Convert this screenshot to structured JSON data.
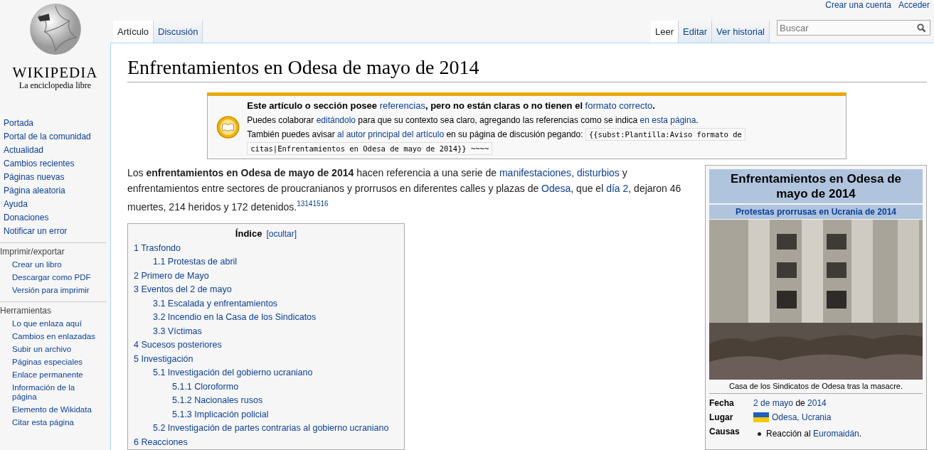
{
  "personal_links": [
    "Crear una cuenta",
    "Acceder"
  ],
  "logo": {
    "wordmark": "WIKIPEDIA",
    "tagline": "La enciclopedia libre"
  },
  "sidebar": {
    "navigation": [
      "Portada",
      "Portal de la comunidad",
      "Actualidad",
      "Cambios recientes",
      "Páginas nuevas",
      "Página aleatoria",
      "Ayuda",
      "Donaciones",
      "Notificar un error"
    ],
    "sections": [
      {
        "heading": "Imprimir/exportar",
        "items": [
          "Crear un libro",
          "Descargar como PDF",
          "Versión para imprimir"
        ]
      },
      {
        "heading": "Herramientas",
        "items": [
          "Lo que enlaza aquí",
          "Cambios en enlazadas",
          "Subir un archivo",
          "Páginas especiales",
          "Enlace permanente",
          "Información de la página",
          "Elemento de Wikidata",
          "Citar esta página"
        ]
      }
    ]
  },
  "left_tabs": [
    {
      "label": "Artículo",
      "selected": true
    },
    {
      "label": "Discusión",
      "selected": false
    }
  ],
  "right_tabs": [
    {
      "label": "Leer",
      "selected": true
    },
    {
      "label": "Editar",
      "selected": false
    },
    {
      "label": "Ver historial",
      "selected": false
    }
  ],
  "search": {
    "placeholder": "Buscar"
  },
  "title": "Enfrentamientos en Odesa de mayo de 2014",
  "notice": {
    "lines": [
      [
        {
          "kind": "bold",
          "text": "Este artículo o sección posee "
        },
        {
          "kind": "link",
          "text": "referencias"
        },
        {
          "kind": "bold",
          "text": ", pero no están claras o no tienen el "
        },
        {
          "kind": "link",
          "text": "formato correcto"
        },
        {
          "kind": "bold",
          "text": "."
        }
      ],
      [
        {
          "kind": "plain",
          "text": "Puedes colaborar "
        },
        {
          "kind": "link",
          "text": "editándolo"
        },
        {
          "kind": "plain",
          "text": " para que su contexto sea claro, agregando las referencias como se indica "
        },
        {
          "kind": "link",
          "text": "en esta página"
        },
        {
          "kind": "plain",
          "text": "."
        }
      ],
      [
        {
          "kind": "plain",
          "text": "También puedes avisar "
        },
        {
          "kind": "link",
          "text": "al autor principal del artículo"
        },
        {
          "kind": "plain",
          "text": " en su página de discusión pegando: "
        },
        {
          "kind": "code",
          "text": "{{subst:Plantilla:Aviso formato de"
        },
        {
          "kind": "code",
          "text": "citas|Enfrentamientos en Odesa de mayo de 2014}} ~~~~"
        }
      ]
    ]
  },
  "intro": [
    {
      "kind": "plain",
      "text": "Los "
    },
    {
      "kind": "bold",
      "text": "enfrentamientos en Odesa de mayo de 2014"
    },
    {
      "kind": "plain",
      "text": " hacen referencia a una serie de "
    },
    {
      "kind": "link",
      "text": "manifestaciones"
    },
    {
      "kind": "plain",
      "text": ", "
    },
    {
      "kind": "link",
      "text": "disturbios"
    },
    {
      "kind": "plain",
      "text": " y enfrentamientos entre sectores de proucranianos y prorrusos en diferentes calles y plazas de "
    },
    {
      "kind": "link",
      "text": "Odesa"
    },
    {
      "kind": "plain",
      "text": ", que el "
    },
    {
      "kind": "link",
      "text": "día 2"
    },
    {
      "kind": "plain",
      "text": ", dejaron 46 muertes, 214 heridos y 172 detenidos."
    },
    {
      "kind": "ref",
      "text": "13"
    },
    {
      "kind": "ref",
      "text": "14"
    },
    {
      "kind": "ref",
      "text": "15"
    },
    {
      "kind": "ref",
      "text": "16"
    }
  ],
  "toc": {
    "title": "Índice",
    "toggle": "[ocultar]",
    "entries": [
      {
        "label": "1 Trasfondo",
        "children": [
          {
            "label": "1.1 Protestas de abril"
          }
        ]
      },
      {
        "label": "2 Primero de Mayo"
      },
      {
        "label": "3 Eventos del 2 de mayo",
        "children": [
          {
            "label": "3.1 Escalada y enfrentamientos"
          },
          {
            "label": "3.2 Incendio en la Casa de los Sindicatos"
          },
          {
            "label": "3.3 Víctimas"
          }
        ]
      },
      {
        "label": "4 Sucesos posteriores"
      },
      {
        "label": "5 Investigación",
        "children": [
          {
            "label": "5.1 Investigación del gobierno ucraniano",
            "children": [
              {
                "label": "5.1.1 Cloroformo"
              },
              {
                "label": "5.1.2 Nacionales rusos"
              },
              {
                "label": "5.1.3 Implicación policial"
              }
            ]
          },
          {
            "label": "5.2 Investigación de partes contrarias al gobierno ucraniano"
          }
        ]
      },
      {
        "label": "6 Reacciones"
      }
    ]
  },
  "infobox": {
    "title": "Enfrentamientos en Odesa de mayo de 2014",
    "subtitle": "Protestas prorrusas en Ucrania de 2014",
    "caption": "Casa de los Sindicatos de Odesa tras la masacre.",
    "rows": [
      {
        "label": "Fecha",
        "value": [
          {
            "kind": "link",
            "text": "2 de mayo"
          },
          {
            "kind": "plain",
            "text": " de "
          },
          {
            "kind": "link",
            "text": "2014"
          }
        ]
      },
      {
        "label": "Lugar",
        "flag": true,
        "value": [
          {
            "kind": "link",
            "text": "Odesa, Ucrania"
          }
        ]
      },
      {
        "label": "Causas",
        "bullets": [
          [
            {
              "kind": "plain",
              "text": "Reacción al "
            },
            {
              "kind": "link",
              "text": "Euromaidán"
            },
            {
              "kind": "plain",
              "text": "."
            }
          ]
        ]
      }
    ]
  }
}
